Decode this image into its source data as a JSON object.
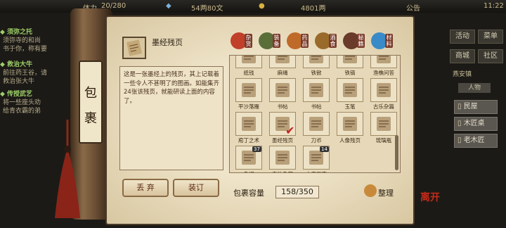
{
  "topbar": {
    "hp": "20/280",
    "money": "54两80文",
    "money2": "4801两",
    "notice": "公告",
    "time": "11:22"
  },
  "quests": [
    {
      "title": "◆ 须弥之托",
      "lines": [
        "须弥寺的和尚",
        "书于你，称有要"
      ]
    },
    {
      "title": "◆ 救治大牛",
      "lines": [
        "前往药王谷，请",
        "救治张大牛"
      ]
    },
    {
      "title": "◆ 传授武艺",
      "lines": [
        "将一些座头劝",
        "给青衣霸的弟"
      ]
    }
  ],
  "right_menu": {
    "activity": "活动",
    "menu": "菜单",
    "shop": "商城",
    "social": "社区",
    "location": "燕安镇",
    "sub": "人物"
  },
  "npcs": [
    "民屋",
    "木匠桌",
    "老木匠"
  ],
  "bag_title": [
    "包",
    "裹"
  ],
  "selected_item": {
    "name": "墨经残页",
    "description": "这是一张墨经上的残页，其上记载着一些令人不甚明了的图画。如能集齐24张该残页，就能研读上面的内容了。"
  },
  "tabs": [
    {
      "label": "杂货",
      "color": "#c0402a",
      "active": true
    },
    {
      "label": "装备",
      "color": "#5a6e3a",
      "active": false
    },
    {
      "label": "药品",
      "color": "#c06a2a",
      "active": false
    },
    {
      "label": "酒食",
      "color": "#9a6a2a",
      "active": false
    },
    {
      "label": "秘籍",
      "color": "#6a3a2a",
      "active": false
    },
    {
      "label": "材料",
      "color": "#3a8ac8",
      "active": false
    }
  ],
  "items": [
    {
      "name": "纸钱",
      "qty": ""
    },
    {
      "name": "麻绳",
      "qty": ""
    },
    {
      "name": "铁锨",
      "qty": ""
    },
    {
      "name": "铁镐",
      "qty": ""
    },
    {
      "name": "渔樵问答",
      "qty": ""
    },
    {
      "name": "平沙落雁",
      "qty": ""
    },
    {
      "name": "书帖",
      "qty": ""
    },
    {
      "name": "书帖",
      "qty": ""
    },
    {
      "name": "玉笔",
      "qty": ""
    },
    {
      "name": "古乐杂篇",
      "qty": ""
    },
    {
      "name": "庖丁之术",
      "qty": ""
    },
    {
      "name": "墨经残页",
      "qty": "",
      "selected": true
    },
    {
      "name": "刀币",
      "qty": ""
    },
    {
      "name": "人像残页",
      "qty": ""
    },
    {
      "name": "琉璃瓶",
      "qty": ""
    },
    {
      "name": "鱼饵",
      "qty": "37"
    },
    {
      "name": "青竹鱼竿",
      "qty": ""
    },
    {
      "name": "文房四宝",
      "qty": "14"
    }
  ],
  "buttons": {
    "discard": "丢 弃",
    "bind": "装订",
    "sort": "整理"
  },
  "capacity": {
    "label": "包裹容量",
    "value": "158/350"
  },
  "logo": "离开"
}
